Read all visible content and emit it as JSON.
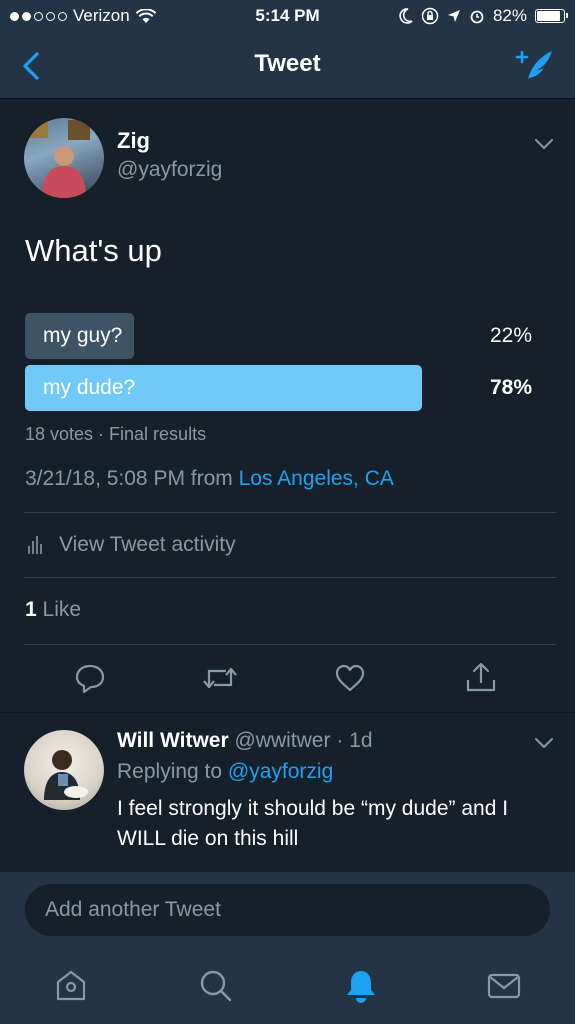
{
  "status_bar": {
    "carrier": "Verizon",
    "time": "5:14 PM",
    "battery": "82%",
    "battery_level": 0.82
  },
  "nav": {
    "title": "Tweet"
  },
  "tweet": {
    "name": "Zig",
    "handle": "@yayforzig",
    "text": "What's up",
    "poll": {
      "options": [
        {
          "label": "my guy?",
          "percent": "22%",
          "value": 22,
          "winner": false
        },
        {
          "label": "my dude?",
          "percent": "78%",
          "value": 78,
          "winner": true
        }
      ],
      "meta": "18 votes · Final results"
    },
    "timestamp": "3/21/18, 5:08 PM from",
    "location": "Los Angeles, CA",
    "activity_label": "View Tweet activity",
    "likes_count": "1",
    "likes_label": "Like"
  },
  "reply": {
    "name": "Will Witwer",
    "handle": "@wwitwer",
    "age": "· 1d",
    "replying_prefix": "Replying to",
    "replying_handle": "@yayforzig",
    "text": "I feel strongly it should be “my dude” and I WILL die on this hill"
  },
  "compose": {
    "placeholder": "Add another Tweet"
  },
  "tabs": [
    "home-icon",
    "search-icon",
    "notifications-icon",
    "messages-icon"
  ],
  "colors": {
    "accent": "#1da1f2",
    "background": "#15202b",
    "bar": "#243447",
    "poll_winner": "#71c9f8",
    "poll_other": "#3d5466",
    "muted": "#8899a6"
  }
}
